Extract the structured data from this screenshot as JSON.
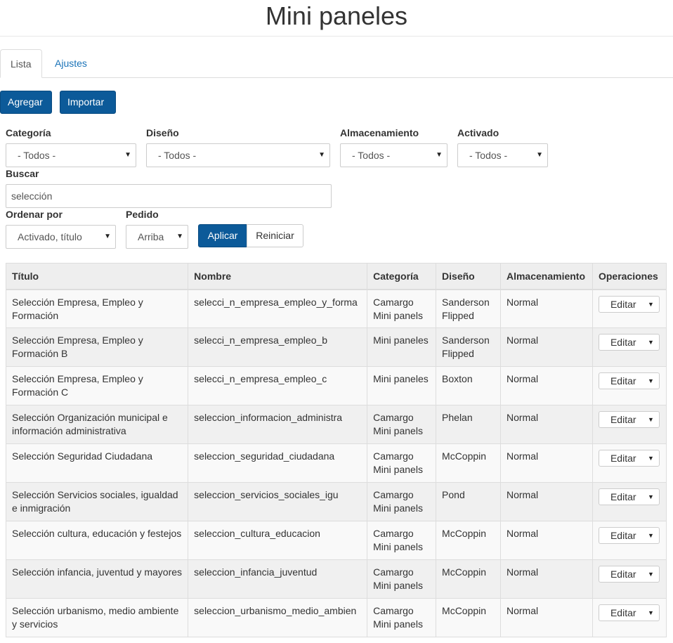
{
  "page": {
    "title": "Mini paneles"
  },
  "tabs": [
    {
      "label": "Lista"
    },
    {
      "label": "Ajustes"
    }
  ],
  "actions": {
    "add_label": "Agregar",
    "import_label": "Importar"
  },
  "filters": {
    "categoria": {
      "label": "Categoría",
      "value": "- Todos -"
    },
    "diseno": {
      "label": "Diseño",
      "value": "- Todos -"
    },
    "almacenamiento": {
      "label": "Almacenamiento",
      "value": "- Todos -"
    },
    "activado": {
      "label": "Activado",
      "value": "- Todos -"
    },
    "buscar": {
      "label": "Buscar",
      "value": "selección"
    },
    "ordenar": {
      "label": "Ordenar por",
      "value": "Activado, título"
    },
    "pedido": {
      "label": "Pedido",
      "value": "Arriba"
    },
    "apply_label": "Aplicar",
    "reset_label": "Reiniciar"
  },
  "table": {
    "headers": [
      "Título",
      "Nombre",
      "Categoría",
      "Diseño",
      "Almacenamiento",
      "Operaciones"
    ],
    "edit_label": "Editar",
    "rows": [
      {
        "title": "Selección Empresa, Empleo y Formación",
        "name": "selecci_n_empresa_empleo_y_forma",
        "category": "Camargo Mini panels",
        "design": "Sanderson Flipped",
        "storage": "Normal"
      },
      {
        "title": "Selección Empresa, Empleo y Formación B",
        "name": "selecci_n_empresa_empleo_b",
        "category": "Mini paneles",
        "design": "Sanderson Flipped",
        "storage": "Normal"
      },
      {
        "title": "Selección Empresa, Empleo y Formación C",
        "name": "selecci_n_empresa_empleo_c",
        "category": "Mini paneles",
        "design": "Boxton",
        "storage": "Normal"
      },
      {
        "title": "Selección Organización municipal e información administrativa",
        "name": "seleccion_informacion_administra",
        "category": "Camargo Mini panels",
        "design": "Phelan",
        "storage": "Normal"
      },
      {
        "title": "Selección Seguridad Ciudadana",
        "name": "seleccion_seguridad_ciudadana",
        "category": "Camargo Mini panels",
        "design": "McCoppin",
        "storage": "Normal"
      },
      {
        "title": "Selección Servicios sociales, igualdad e inmigración",
        "name": "seleccion_servicios_sociales_igu",
        "category": "Camargo Mini panels",
        "design": "Pond",
        "storage": "Normal"
      },
      {
        "title": "Selección cultura, educación y festejos",
        "name": "seleccion_cultura_educacion",
        "category": "Camargo Mini panels",
        "design": "McCoppin",
        "storage": "Normal"
      },
      {
        "title": "Selección infancia, juventud y mayores",
        "name": "seleccion_infancia_juventud",
        "category": "Camargo Mini panels",
        "design": "McCoppin",
        "storage": "Normal"
      },
      {
        "title": "Selección urbanismo, medio ambiente y servicios",
        "name": "seleccion_urbanismo_medio_ambien",
        "category": "Camargo Mini panels",
        "design": "McCoppin",
        "storage": "Normal"
      }
    ]
  }
}
